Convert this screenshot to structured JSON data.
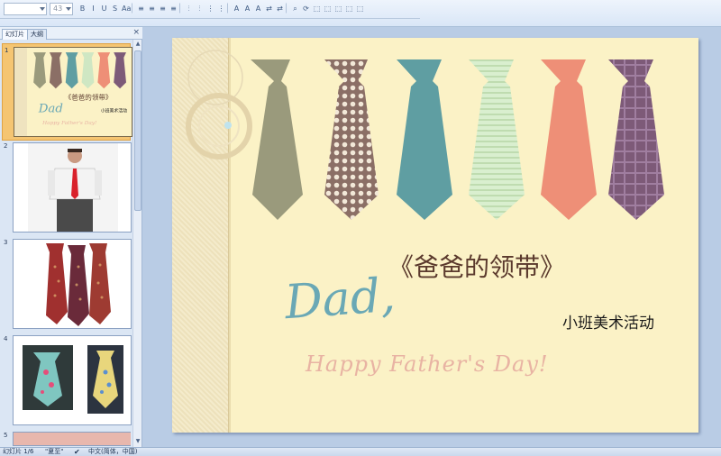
{
  "ribbon": {
    "font_size": "43",
    "tools": [
      "B",
      "I",
      "U",
      "S",
      "Aa",
      "≡",
      "≡",
      "≡",
      "≡",
      "⫶",
      "⫶",
      "⋮",
      "⋮",
      "A",
      "A",
      "A",
      "⇄",
      "⇄",
      "⌕",
      "⟳",
      "⬚",
      "⬚",
      "⬚",
      "⬚",
      "⬚"
    ]
  },
  "panel": {
    "tabs": [
      "幻灯片",
      "大纲"
    ],
    "close_glyph": "×"
  },
  "thumbs": [
    {
      "num": "1",
      "title": "《爸爸的领带》",
      "dad": "Dad",
      "sub": "小班美术活动",
      "happy": "Happy Father's Day!"
    },
    {
      "num": "2"
    },
    {
      "num": "3"
    },
    {
      "num": "4"
    },
    {
      "num": "5"
    }
  ],
  "slide": {
    "title": "《爸爸的领带》",
    "dad": "Dad,",
    "subtitle": "小班美术活动",
    "happy": "Happy Father's Day!"
  },
  "status": {
    "slide_info": "幻灯片 1/6",
    "theme": "\"夏至\"",
    "language": "中文(简体，中国)"
  },
  "colors": {
    "tie_olive": "#9a9a7c",
    "tie_brown": "#8b6f66",
    "tie_teal": "#5f9ea2",
    "tie_mint": "#cfe7c3",
    "tie_salmon": "#ee8f77",
    "tie_purple": "#7d5a78"
  }
}
